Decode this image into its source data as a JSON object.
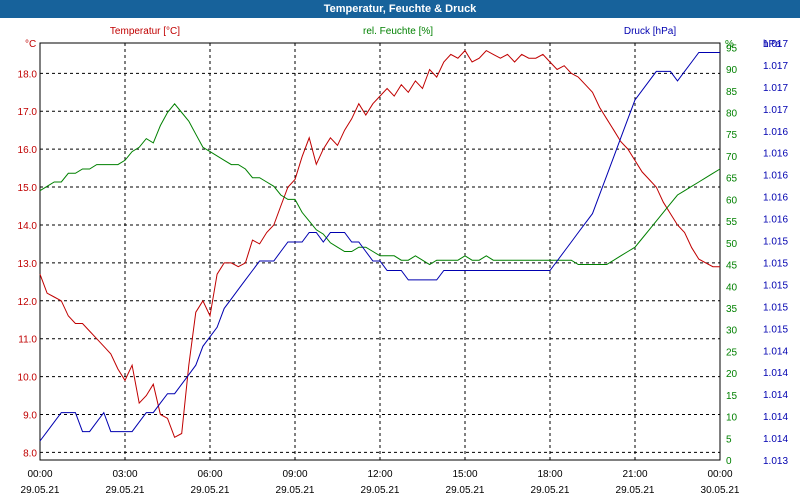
{
  "window": {
    "title": "Temperatur, Feuchte & Druck"
  },
  "colors": {
    "temperature": "#c00000",
    "humidity": "#008000",
    "pressure": "#0000b0",
    "grid": "#000000",
    "titlebar": "#17629b"
  },
  "chart_data": {
    "type": "line",
    "title": "Temperatur, Feuchte & Druck",
    "grid": true,
    "x": [
      "00:00",
      "00:15",
      "00:30",
      "00:45",
      "01:00",
      "01:15",
      "01:30",
      "01:45",
      "02:00",
      "02:15",
      "02:30",
      "02:45",
      "03:00",
      "03:15",
      "03:30",
      "03:45",
      "04:00",
      "04:15",
      "04:30",
      "04:45",
      "05:00",
      "05:15",
      "05:30",
      "05:45",
      "06:00",
      "06:15",
      "06:30",
      "06:45",
      "07:00",
      "07:15",
      "07:30",
      "07:45",
      "08:00",
      "08:15",
      "08:30",
      "08:45",
      "09:00",
      "09:15",
      "09:30",
      "09:45",
      "10:00",
      "10:15",
      "10:30",
      "10:45",
      "11:00",
      "11:15",
      "11:30",
      "11:45",
      "12:00",
      "12:15",
      "12:30",
      "12:45",
      "13:00",
      "13:15",
      "13:30",
      "13:45",
      "14:00",
      "14:15",
      "14:30",
      "14:45",
      "15:00",
      "15:15",
      "15:30",
      "15:45",
      "16:00",
      "16:15",
      "16:30",
      "16:45",
      "17:00",
      "17:15",
      "17:30",
      "17:45",
      "18:00",
      "18:15",
      "18:30",
      "18:45",
      "19:00",
      "19:15",
      "19:30",
      "19:45",
      "20:00",
      "20:15",
      "20:30",
      "20:45",
      "21:00",
      "21:15",
      "21:30",
      "21:45",
      "22:00",
      "22:15",
      "22:30",
      "22:45",
      "23:00",
      "23:15",
      "23:30",
      "23:45",
      "00:00"
    ],
    "x_ticks": [
      {
        "time": "00:00",
        "date": "29.05.21"
      },
      {
        "time": "03:00",
        "date": "29.05.21"
      },
      {
        "time": "06:00",
        "date": "29.05.21"
      },
      {
        "time": "09:00",
        "date": "29.05.21"
      },
      {
        "time": "12:00",
        "date": "29.05.21"
      },
      {
        "time": "15:00",
        "date": "29.05.21"
      },
      {
        "time": "18:00",
        "date": "29.05.21"
      },
      {
        "time": "21:00",
        "date": "29.05.21"
      },
      {
        "time": "00:00",
        "date": "30.05.21"
      }
    ],
    "axes": {
      "left": {
        "label": "Temperatur [°C]",
        "unit": "°C",
        "ylim": [
          7.8,
          18.8
        ],
        "ticks": [
          "8.0",
          "9.0",
          "10.0",
          "11.0",
          "12.0",
          "13.0",
          "14.0",
          "15.0",
          "16.0",
          "17.0",
          "18.0"
        ]
      },
      "right1": {
        "label": "rel. Feuchte [%]",
        "unit": "%",
        "ylim": [
          0,
          96
        ],
        "ticks": [
          "0",
          "5",
          "10",
          "15",
          "20",
          "25",
          "30",
          "35",
          "40",
          "45",
          "50",
          "55",
          "60",
          "65",
          "70",
          "75",
          "80",
          "85",
          "90",
          "95"
        ]
      },
      "right2": {
        "label": "Druck [hPa]",
        "unit": "hPa",
        "ylim": [
          1013.0,
          1017.4
        ],
        "ticks": [
          "1.013",
          "1.014",
          "1.014",
          "1.014",
          "1.014",
          "1.014",
          "1.015",
          "1.015",
          "1.015",
          "1.015",
          "1.015",
          "1.016",
          "1.016",
          "1.016",
          "1.016",
          "1.016",
          "1.017",
          "1.017",
          "1.017",
          "1.017"
        ]
      }
    },
    "series": [
      {
        "name": "Temperatur [°C]",
        "axis": "left",
        "color": "#c00000",
        "values": [
          12.7,
          12.2,
          12.1,
          12.0,
          11.6,
          11.4,
          11.4,
          11.2,
          11.0,
          10.8,
          10.6,
          10.2,
          9.9,
          10.3,
          9.3,
          9.5,
          9.8,
          9.0,
          8.9,
          8.4,
          8.5,
          10.3,
          11.7,
          12.0,
          11.6,
          12.7,
          13.0,
          13.0,
          12.9,
          13.0,
          13.6,
          13.5,
          13.8,
          14.0,
          14.5,
          15.0,
          15.2,
          15.8,
          16.3,
          15.6,
          16.0,
          16.3,
          16.1,
          16.5,
          16.8,
          17.2,
          16.9,
          17.2,
          17.4,
          17.6,
          17.4,
          17.7,
          17.5,
          17.8,
          17.6,
          18.1,
          17.9,
          18.3,
          18.5,
          18.4,
          18.6,
          18.3,
          18.4,
          18.6,
          18.5,
          18.4,
          18.5,
          18.3,
          18.5,
          18.4,
          18.4,
          18.5,
          18.3,
          18.1,
          18.2,
          18.0,
          17.9,
          17.7,
          17.5,
          17.1,
          16.8,
          16.5,
          16.2,
          16.0,
          15.7,
          15.4,
          15.2,
          15.0,
          14.6,
          14.3,
          14.0,
          13.8,
          13.4,
          13.1,
          13.0,
          12.9,
          12.9
        ]
      },
      {
        "name": "rel. Feuchte [%]",
        "axis": "right1",
        "color": "#008000",
        "values": [
          62,
          63,
          64,
          64,
          66,
          66,
          67,
          67,
          68,
          68,
          68,
          68,
          69,
          71,
          72,
          74,
          73,
          77,
          80,
          82,
          80,
          78,
          75,
          72,
          71,
          70,
          69,
          68,
          68,
          67,
          65,
          65,
          64,
          63,
          61,
          60,
          60,
          57,
          55,
          53,
          52,
          50,
          49,
          48,
          48,
          49,
          49,
          48,
          47,
          47,
          47,
          46,
          46,
          47,
          46,
          45,
          46,
          46,
          46,
          46,
          47,
          46,
          46,
          47,
          46,
          46,
          46,
          46,
          46,
          46,
          46,
          46,
          46,
          46,
          46,
          46,
          45,
          45,
          45,
          45,
          45,
          46,
          47,
          48,
          49,
          51,
          53,
          55,
          57,
          59,
          61,
          62,
          63,
          64,
          65,
          66,
          67
        ]
      },
      {
        "name": "Druck [hPa]",
        "axis": "right2",
        "color": "#0000b0",
        "values": [
          1013.2,
          1013.3,
          1013.4,
          1013.5,
          1013.5,
          1013.5,
          1013.3,
          1013.3,
          1013.4,
          1013.5,
          1013.3,
          1013.3,
          1013.3,
          1013.3,
          1013.4,
          1013.5,
          1013.5,
          1013.6,
          1013.7,
          1013.7,
          1013.8,
          1013.9,
          1014.0,
          1014.2,
          1014.3,
          1014.4,
          1014.6,
          1014.7,
          1014.8,
          1014.9,
          1015.0,
          1015.1,
          1015.1,
          1015.1,
          1015.2,
          1015.3,
          1015.3,
          1015.3,
          1015.4,
          1015.4,
          1015.3,
          1015.4,
          1015.4,
          1015.4,
          1015.3,
          1015.3,
          1015.2,
          1015.1,
          1015.1,
          1015.0,
          1015.0,
          1015.0,
          1014.9,
          1014.9,
          1014.9,
          1014.9,
          1014.9,
          1015.0,
          1015.0,
          1015.0,
          1015.0,
          1015.0,
          1015.0,
          1015.0,
          1015.0,
          1015.0,
          1015.0,
          1015.0,
          1015.0,
          1015.0,
          1015.0,
          1015.0,
          1015.0,
          1015.1,
          1015.2,
          1015.3,
          1015.4,
          1015.5,
          1015.6,
          1015.8,
          1016.0,
          1016.2,
          1016.4,
          1016.6,
          1016.8,
          1016.9,
          1017.0,
          1017.1,
          1017.1,
          1017.1,
          1017.0,
          1017.1,
          1017.2,
          1017.3,
          1017.3,
          1017.3,
          1017.3
        ]
      }
    ]
  }
}
